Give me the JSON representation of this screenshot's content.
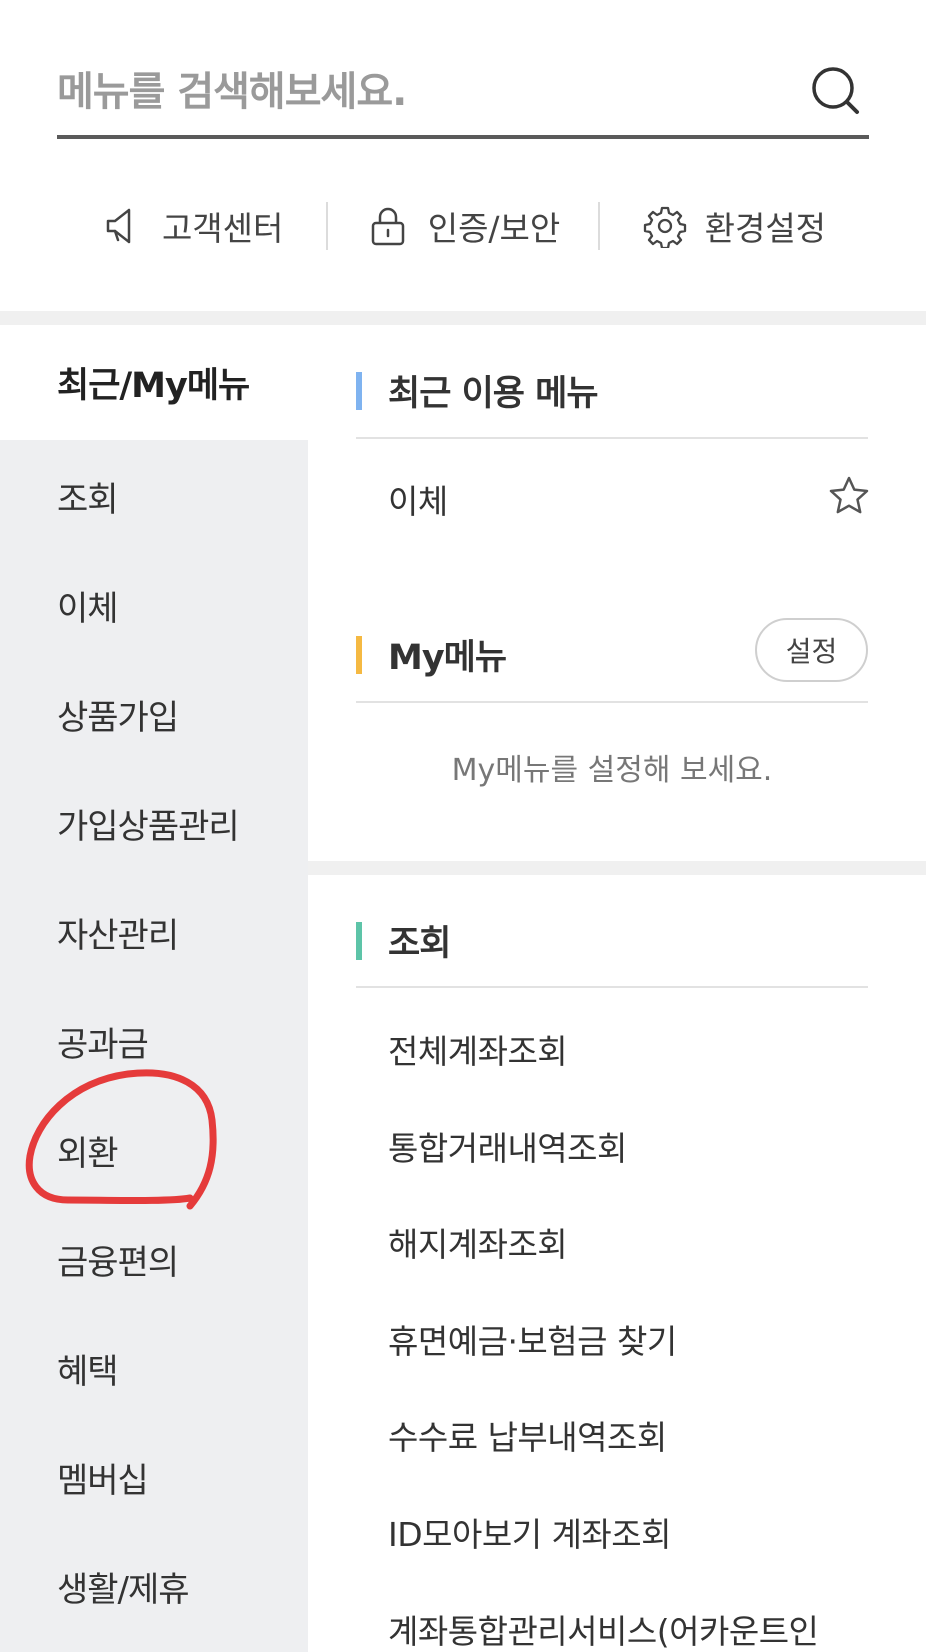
{
  "search": {
    "placeholder": "메뉴를 검색해보세요."
  },
  "quick_links": [
    {
      "label": "고객센터",
      "icon": "megaphone-icon"
    },
    {
      "label": "인증/보안",
      "icon": "lock-icon"
    },
    {
      "label": "환경설정",
      "icon": "gear-icon"
    }
  ],
  "nav": {
    "header": "최근/My메뉴",
    "items": [
      "조회",
      "이체",
      "상품가입",
      "가입상품관리",
      "자산관리",
      "공과금",
      "외환",
      "금융편의",
      "혜택",
      "멤버십",
      "생활/제휴"
    ]
  },
  "recent": {
    "title": "최근 이용 메뉴",
    "items": [
      "이체"
    ]
  },
  "mymenu": {
    "title": "My메뉴",
    "button": "설정",
    "empty": "My메뉴를 설정해 보세요."
  },
  "inquiry": {
    "title": "조회",
    "items": [
      "전체계좌조회",
      "통합거래내역조회",
      "해지계좌조회",
      "휴면예금·보험금 찾기",
      "수수료 납부내역조회",
      "ID모아보기 계좌조회",
      "계좌통합관리서비스(어카운트인"
    ]
  },
  "colors": {
    "recent_bar": "#7fb3f0",
    "mymenu_bar": "#f5b942",
    "inquiry_bar": "#5dc4a8",
    "annotation": "#e53b3b"
  }
}
